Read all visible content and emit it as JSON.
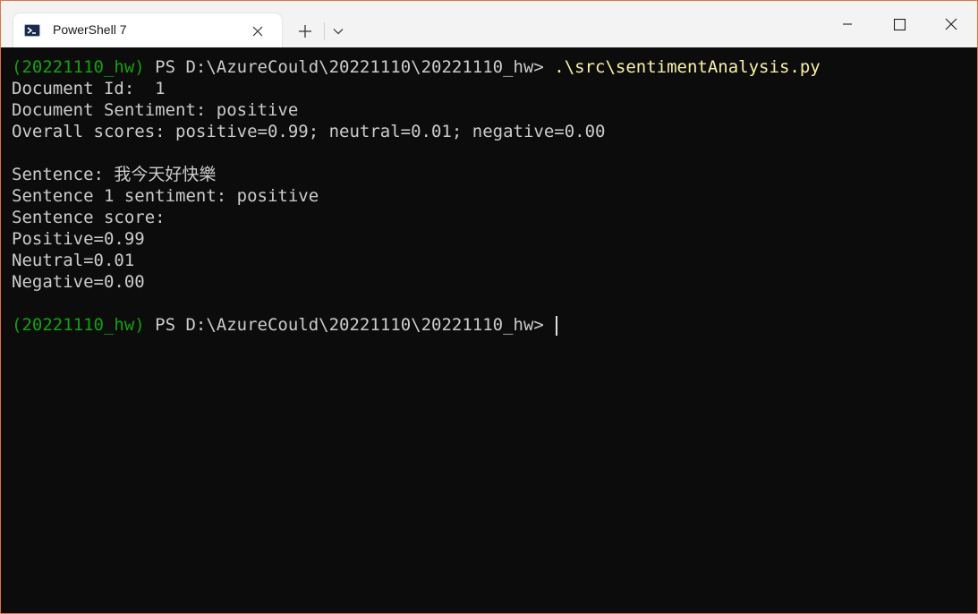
{
  "window": {
    "tab_title": "PowerShell 7",
    "accent_border": "#e0743f",
    "icons": {
      "tab": "powershell-icon",
      "close_tab": "close-icon",
      "new_tab": "plus-icon",
      "dropdown": "chevron-down-icon",
      "minimize": "minimize-icon",
      "maximize": "maximize-icon",
      "close": "close-icon"
    }
  },
  "terminal": {
    "background": "#0c0c0c",
    "prompt_env": "(20221110_hw)",
    "prompt_path": " PS D:\\AzureCould\\20221110\\20221110_hw> ",
    "command": ".\\src\\sentimentAnalysis.py",
    "output": [
      "Document Id:  1",
      "Document Sentiment: positive",
      "Overall scores: positive=0.99; neutral=0.01; negative=0.00",
      "",
      "Sentence: 我今天好快樂",
      "Sentence 1 sentiment: positive",
      "Sentence score:",
      "Positive=0.99",
      "Neutral=0.01",
      "Negative=0.00",
      ""
    ],
    "prompt2_env": "(20221110_hw)",
    "prompt2_path": " PS D:\\AzureCould\\20221110\\20221110_hw> "
  }
}
